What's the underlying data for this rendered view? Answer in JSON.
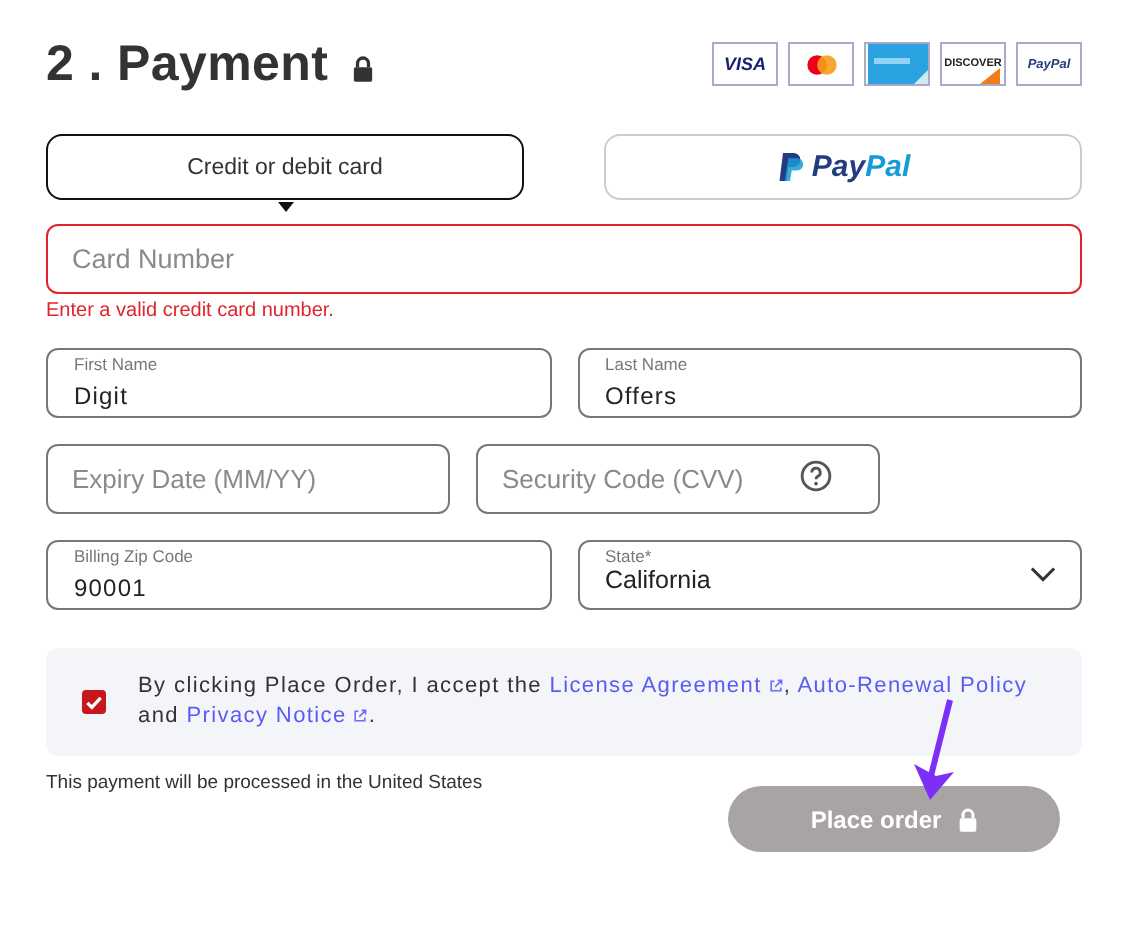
{
  "header": {
    "title": "2 . Payment",
    "secure": true
  },
  "card_brands": [
    {
      "kind": "visa",
      "label": "VISA"
    },
    {
      "kind": "mastercard"
    },
    {
      "kind": "amex"
    },
    {
      "kind": "discover",
      "label": "DISCOVER"
    },
    {
      "kind": "paypal",
      "label": "PayPal"
    }
  ],
  "tabs": [
    {
      "kind": "text",
      "label": "Credit or debit card",
      "selected": true
    },
    {
      "kind": "paypal",
      "label": "PayPal",
      "selected": false
    }
  ],
  "card_number": {
    "placeholder": "Card Number",
    "error": true,
    "error_message": "Enter a valid credit card number."
  },
  "field_rows": [
    [
      {
        "kind": "filled",
        "label": "First Name",
        "value": "Digit"
      },
      {
        "kind": "filled",
        "label": "Last Name",
        "value": "Offers"
      }
    ],
    [
      {
        "kind": "empty",
        "placeholder": "Expiry Date (MM/YY)"
      },
      {
        "kind": "empty",
        "placeholder": "Security Code (CVV)",
        "help": true
      }
    ],
    [
      {
        "kind": "filled",
        "label": "Billing Zip Code",
        "value": "90001"
      },
      {
        "kind": "select",
        "label": "State*",
        "value": "California"
      }
    ]
  ],
  "consent": {
    "checked": true,
    "segments": [
      {
        "text": "By clicking Place Order, I accept the "
      },
      {
        "text": "License Agreement",
        "link": true,
        "external": true
      },
      {
        "text": ", "
      },
      {
        "text": "Auto-Renewal Policy",
        "link": true,
        "external": false
      },
      {
        "text": " and "
      },
      {
        "text": "Privacy Notice",
        "link": true,
        "external": true
      },
      {
        "text": "."
      }
    ]
  },
  "note": "This payment will be processed in the United States",
  "place_order": {
    "label": "Place order",
    "disabled": true
  },
  "annotation_arrow": true
}
